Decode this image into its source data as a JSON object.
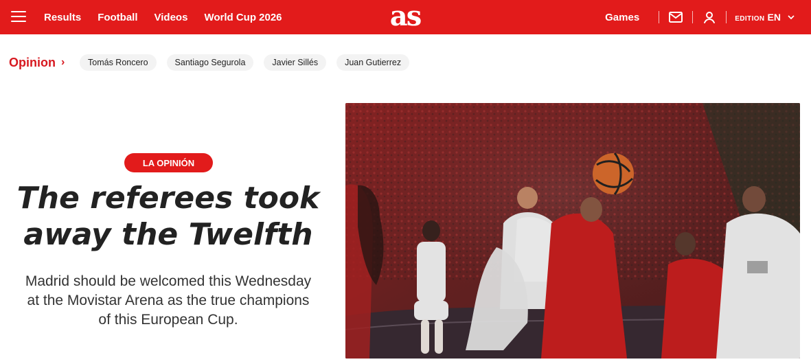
{
  "header": {
    "nav": [
      "Results",
      "Football",
      "Videos",
      "World Cup 2026"
    ],
    "logo": "as",
    "games": "Games",
    "edition_label": "EDITION",
    "edition_value": "EN",
    "colors": {
      "brand": "#e21b1b"
    }
  },
  "subnav": {
    "section": "Opinion",
    "authors": [
      "Tomás Roncero",
      "Santiago Segurola",
      "Javier Sillés",
      "Juan Gutierrez"
    ]
  },
  "article": {
    "badge": "LA OPINIÓN",
    "headline_line1": "The referees took",
    "headline_line2": "away the Twelfth",
    "deck_line1": "Madrid should be welcomed this Wednesday",
    "deck_line2": "at the Movistar Arena as the true champions",
    "deck_line3": "of this European Cup."
  }
}
